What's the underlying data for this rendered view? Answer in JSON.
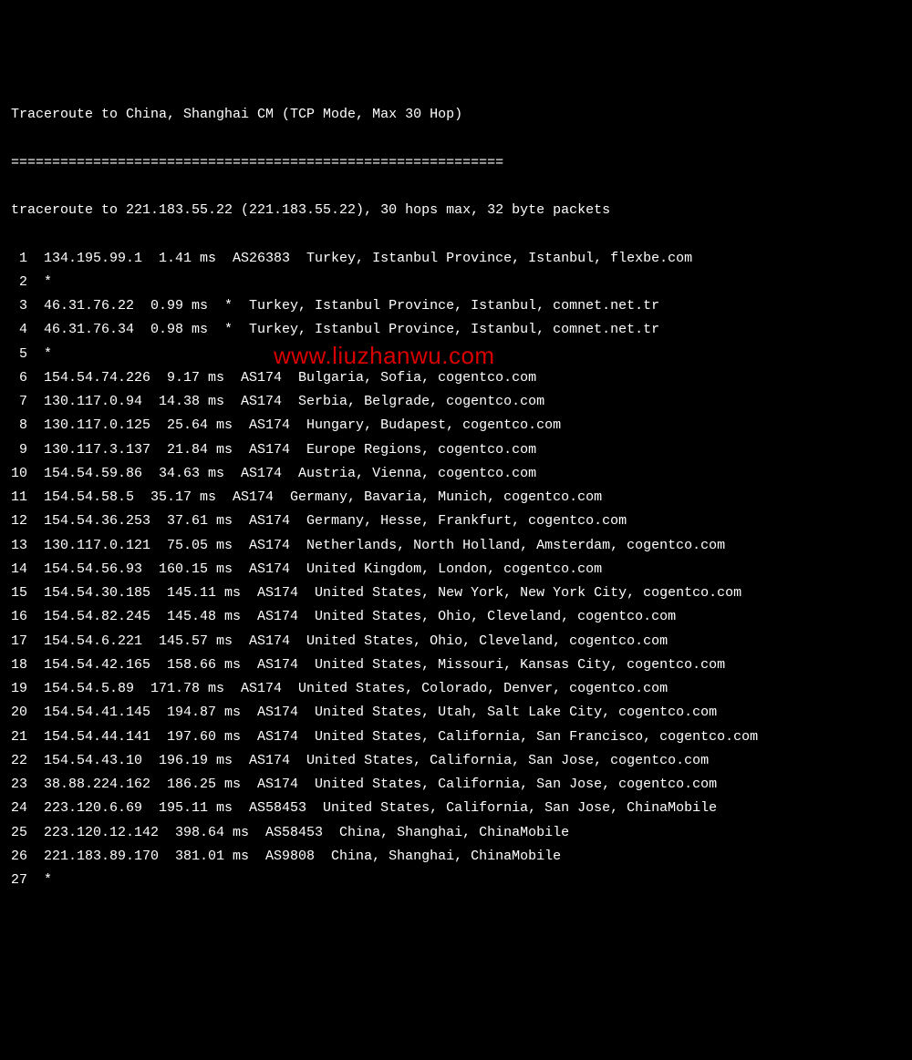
{
  "header": {
    "title": "Traceroute to China, Shanghai CM (TCP Mode, Max 30 Hop)",
    "separator": "============================================================",
    "command": "traceroute to 221.183.55.22 (221.183.55.22), 30 hops max, 32 byte packets"
  },
  "watermark": "www.liuzhanwu.com",
  "hops": [
    {
      "num": " 1",
      "ip": "134.195.99.1",
      "latency": "1.41 ms",
      "asn": "AS26383",
      "location": "Turkey, Istanbul Province, Istanbul, flexbe.com"
    },
    {
      "num": " 2",
      "ip": "*",
      "latency": "",
      "asn": "",
      "location": ""
    },
    {
      "num": " 3",
      "ip": "46.31.76.22",
      "latency": "0.99 ms",
      "asn": "*",
      "location": "Turkey, Istanbul Province, Istanbul, comnet.net.tr"
    },
    {
      "num": " 4",
      "ip": "46.31.76.34",
      "latency": "0.98 ms",
      "asn": "*",
      "location": "Turkey, Istanbul Province, Istanbul, comnet.net.tr"
    },
    {
      "num": " 5",
      "ip": "*",
      "latency": "",
      "asn": "",
      "location": ""
    },
    {
      "num": " 6",
      "ip": "154.54.74.226",
      "latency": "9.17 ms",
      "asn": "AS174",
      "location": "Bulgaria, Sofia, cogentco.com"
    },
    {
      "num": " 7",
      "ip": "130.117.0.94",
      "latency": "14.38 ms",
      "asn": "AS174",
      "location": "Serbia, Belgrade, cogentco.com"
    },
    {
      "num": " 8",
      "ip": "130.117.0.125",
      "latency": "25.64 ms",
      "asn": "AS174",
      "location": "Hungary, Budapest, cogentco.com"
    },
    {
      "num": " 9",
      "ip": "130.117.3.137",
      "latency": "21.84 ms",
      "asn": "AS174",
      "location": "Europe Regions, cogentco.com"
    },
    {
      "num": "10",
      "ip": "154.54.59.86",
      "latency": "34.63 ms",
      "asn": "AS174",
      "location": "Austria, Vienna, cogentco.com"
    },
    {
      "num": "11",
      "ip": "154.54.58.5",
      "latency": "35.17 ms",
      "asn": "AS174",
      "location": "Germany, Bavaria, Munich, cogentco.com"
    },
    {
      "num": "12",
      "ip": "154.54.36.253",
      "latency": "37.61 ms",
      "asn": "AS174",
      "location": "Germany, Hesse, Frankfurt, cogentco.com"
    },
    {
      "num": "13",
      "ip": "130.117.0.121",
      "latency": "75.05 ms",
      "asn": "AS174",
      "location": "Netherlands, North Holland, Amsterdam, cogentco.com"
    },
    {
      "num": "14",
      "ip": "154.54.56.93",
      "latency": "160.15 ms",
      "asn": "AS174",
      "location": "United Kingdom, London, cogentco.com"
    },
    {
      "num": "15",
      "ip": "154.54.30.185",
      "latency": "145.11 ms",
      "asn": "AS174",
      "location": "United States, New York, New York City, cogentco.com"
    },
    {
      "num": "16",
      "ip": "154.54.82.245",
      "latency": "145.48 ms",
      "asn": "AS174",
      "location": "United States, Ohio, Cleveland, cogentco.com"
    },
    {
      "num": "17",
      "ip": "154.54.6.221",
      "latency": "145.57 ms",
      "asn": "AS174",
      "location": "United States, Ohio, Cleveland, cogentco.com"
    },
    {
      "num": "18",
      "ip": "154.54.42.165",
      "latency": "158.66 ms",
      "asn": "AS174",
      "location": "United States, Missouri, Kansas City, cogentco.com"
    },
    {
      "num": "19",
      "ip": "154.54.5.89",
      "latency": "171.78 ms",
      "asn": "AS174",
      "location": "United States, Colorado, Denver, cogentco.com"
    },
    {
      "num": "20",
      "ip": "154.54.41.145",
      "latency": "194.87 ms",
      "asn": "AS174",
      "location": "United States, Utah, Salt Lake City, cogentco.com"
    },
    {
      "num": "21",
      "ip": "154.54.44.141",
      "latency": "197.60 ms",
      "asn": "AS174",
      "location": "United States, California, San Francisco, cogentco.com"
    },
    {
      "num": "22",
      "ip": "154.54.43.10",
      "latency": "196.19 ms",
      "asn": "AS174",
      "location": "United States, California, San Jose, cogentco.com"
    },
    {
      "num": "23",
      "ip": "38.88.224.162",
      "latency": "186.25 ms",
      "asn": "AS174",
      "location": "United States, California, San Jose, cogentco.com"
    },
    {
      "num": "24",
      "ip": "223.120.6.69",
      "latency": "195.11 ms",
      "asn": "AS58453",
      "location": "United States, California, San Jose, ChinaMobile"
    },
    {
      "num": "25",
      "ip": "223.120.12.142",
      "latency": "398.64 ms",
      "asn": "AS58453",
      "location": "China, Shanghai, ChinaMobile"
    },
    {
      "num": "26",
      "ip": "221.183.89.170",
      "latency": "381.01 ms",
      "asn": "AS9808",
      "location": "China, Shanghai, ChinaMobile"
    },
    {
      "num": "27",
      "ip": "*",
      "latency": "",
      "asn": "",
      "location": ""
    }
  ]
}
